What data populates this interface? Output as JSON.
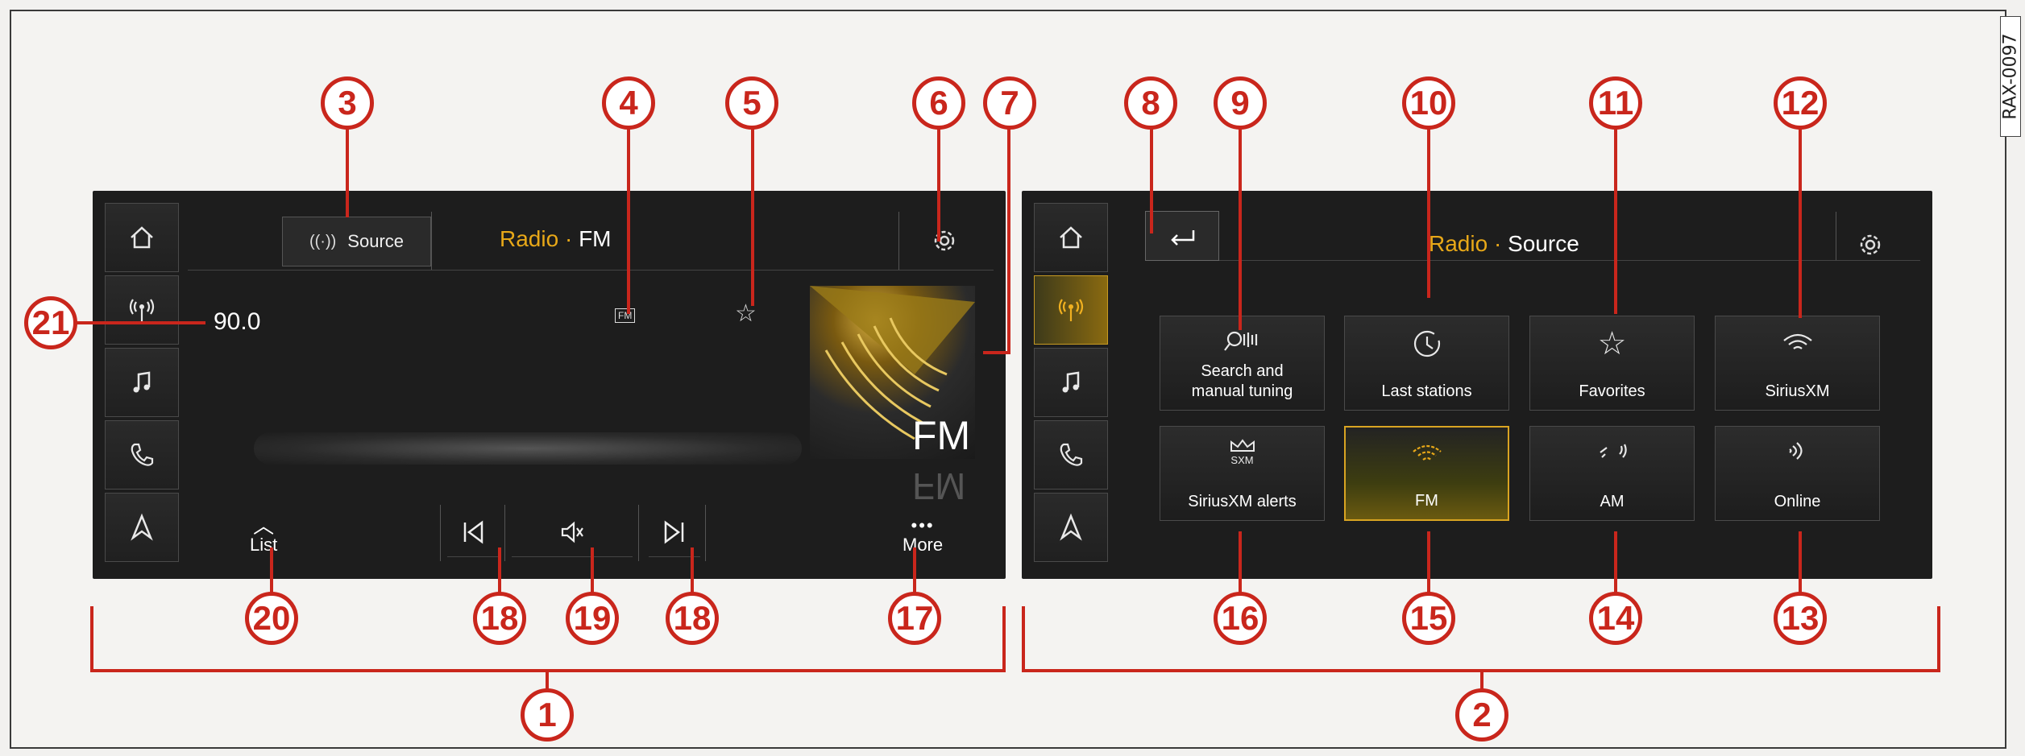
{
  "figure_code": "RAX-0097",
  "screen1": {
    "source_label": "Source",
    "title_main": "Radio",
    "title_dot": "·",
    "title_sub": "FM",
    "frequency": "90.0",
    "fm_chip": "FM",
    "art_label": "FM",
    "list_label": "List",
    "more_label": "More"
  },
  "screen2": {
    "title_main": "Radio",
    "title_dot": "·",
    "title_sub": "Source",
    "tiles": [
      {
        "label": "Search and manual tuning"
      },
      {
        "label": "Last stations"
      },
      {
        "label": "Favorites"
      },
      {
        "label": "SiriusXM"
      },
      {
        "label": "SiriusXM alerts",
        "icon_text": "SXM"
      },
      {
        "label": "FM",
        "active": true
      },
      {
        "label": "AM"
      },
      {
        "label": "Online"
      }
    ]
  },
  "sidebar_icons": [
    "home-icon",
    "radio-icon",
    "music-icon",
    "phone-icon",
    "navigation-icon"
  ],
  "callouts": [
    "1",
    "2",
    "3",
    "4",
    "5",
    "6",
    "7",
    "8",
    "9",
    "10",
    "11",
    "12",
    "13",
    "14",
    "15",
    "16",
    "17",
    "18",
    "19",
    "20",
    "21"
  ],
  "colors": {
    "accent": "#e8a818",
    "callout": "#c9261c",
    "screen_bg": "#1d1d1d"
  }
}
